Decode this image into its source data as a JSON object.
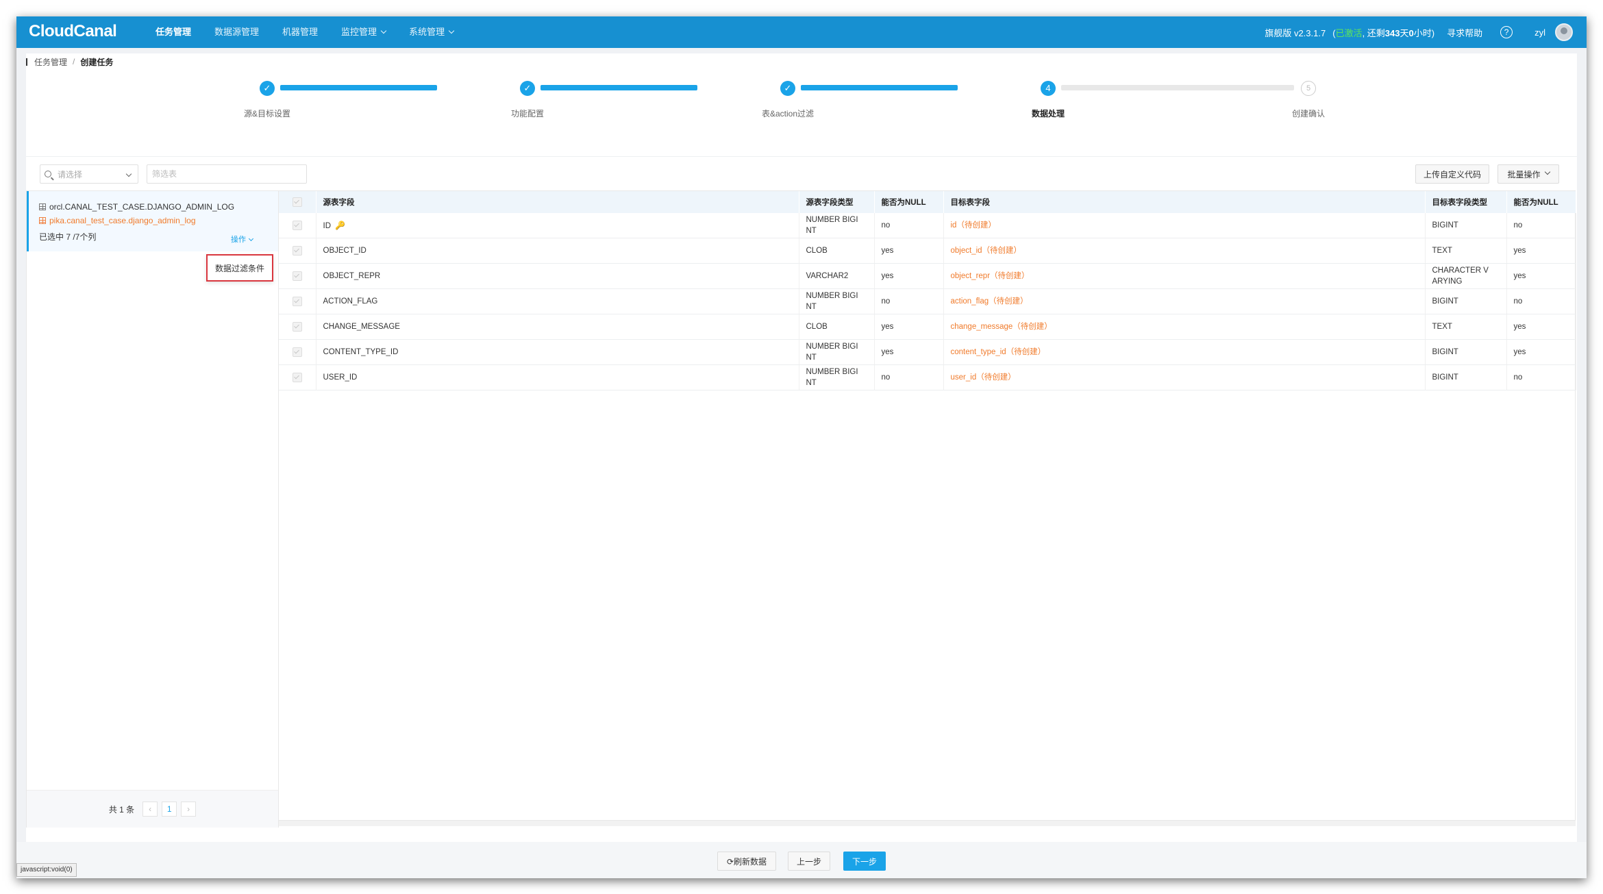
{
  "header": {
    "logo": "CloudCanal",
    "nav": [
      {
        "label": "任务管理",
        "active": true,
        "dropdown": false
      },
      {
        "label": "数据源管理",
        "active": false,
        "dropdown": false
      },
      {
        "label": "机器管理",
        "active": false,
        "dropdown": false
      },
      {
        "label": "监控管理",
        "active": false,
        "dropdown": true
      },
      {
        "label": "系统管理",
        "active": false,
        "dropdown": true
      }
    ],
    "version": "旗舰版 v2.3.1.7",
    "activated_prefix": "(",
    "activated": "已激活",
    "remaining_prefix": ", 还剩",
    "remaining_days": "343",
    "remaining_mid": "天",
    "remaining_hours": "0",
    "remaining_suffix": "小时)",
    "help_label": "寻求帮助",
    "help_icon": "?",
    "username": "zyl"
  },
  "breadcrumb": {
    "parent": "任务管理",
    "separator": "/",
    "current": "创建任务"
  },
  "steps": [
    {
      "label": "源&目标设置",
      "status": "done"
    },
    {
      "label": "功能配置",
      "status": "done"
    },
    {
      "label": "表&action过滤",
      "status": "done"
    },
    {
      "label": "数据处理",
      "status": "current",
      "number": "4"
    },
    {
      "label": "创建确认",
      "status": "todo",
      "number": "5"
    }
  ],
  "filters": {
    "select_placeholder": "请选择",
    "search_placeholder": "筛选表",
    "upload_code": "上传自定义代码",
    "batch_ops": "批量操作"
  },
  "left_panel": {
    "source_table": "orcl.CANAL_TEST_CASE.DJANGO_ADMIN_LOG",
    "target_table": "pika.canal_test_case.django_admin_log",
    "selected_count": "已选中 7 /7个列",
    "operation": "操作",
    "popup_item": "数据过滤条件",
    "pager": {
      "total": "共 1 条",
      "prev": "‹",
      "page": "1",
      "next": "›"
    }
  },
  "table": {
    "columns": [
      "源表字段",
      "源表字段类型",
      "能否为NULL",
      "目标表字段",
      "目标表字段类型",
      "能否为NULL"
    ],
    "rows": [
      {
        "src": "ID",
        "src_type": "NUMBER BIGI NT",
        "src_null": "no",
        "tgt": "id（待创建）",
        "tgt_type": "BIGINT",
        "tgt_null": "no",
        "pk": true
      },
      {
        "src": "OBJECT_ID",
        "src_type": "CLOB",
        "src_null": "yes",
        "tgt": "object_id（待创建）",
        "tgt_type": "TEXT",
        "tgt_null": "yes",
        "pk": false
      },
      {
        "src": "OBJECT_REPR",
        "src_type": "VARCHAR2",
        "src_null": "yes",
        "tgt": "object_repr（待创建）",
        "tgt_type": "CHARACTER V ARYING",
        "tgt_null": "yes",
        "pk": false
      },
      {
        "src": "ACTION_FLAG",
        "src_type": "NUMBER BIGI NT",
        "src_null": "no",
        "tgt": "action_flag（待创建）",
        "tgt_type": "BIGINT",
        "tgt_null": "no",
        "pk": false
      },
      {
        "src": "CHANGE_MESSAGE",
        "src_type": "CLOB",
        "src_null": "yes",
        "tgt": "change_message（待创建）",
        "tgt_type": "TEXT",
        "tgt_null": "yes",
        "pk": false
      },
      {
        "src": "CONTENT_TYPE_ID",
        "src_type": "NUMBER BIGI NT",
        "src_null": "yes",
        "tgt": "content_type_id（待创建）",
        "tgt_type": "BIGINT",
        "tgt_null": "yes",
        "pk": false
      },
      {
        "src": "USER_ID",
        "src_type": "NUMBER BIGI NT",
        "src_null": "no",
        "tgt": "user_id（待创建）",
        "tgt_type": "BIGINT",
        "tgt_null": "no",
        "pk": false
      }
    ]
  },
  "footer": {
    "refresh": "⟳刷新数据",
    "prev": "上一步",
    "next": "下一步"
  },
  "status_bar": "javascript:void(0)",
  "colors": {
    "primary": "#1790d1",
    "accent": "#1aa3e8",
    "target_text": "#f07a2a",
    "activated": "#5ee65a",
    "highlight_border": "#d9363e"
  }
}
